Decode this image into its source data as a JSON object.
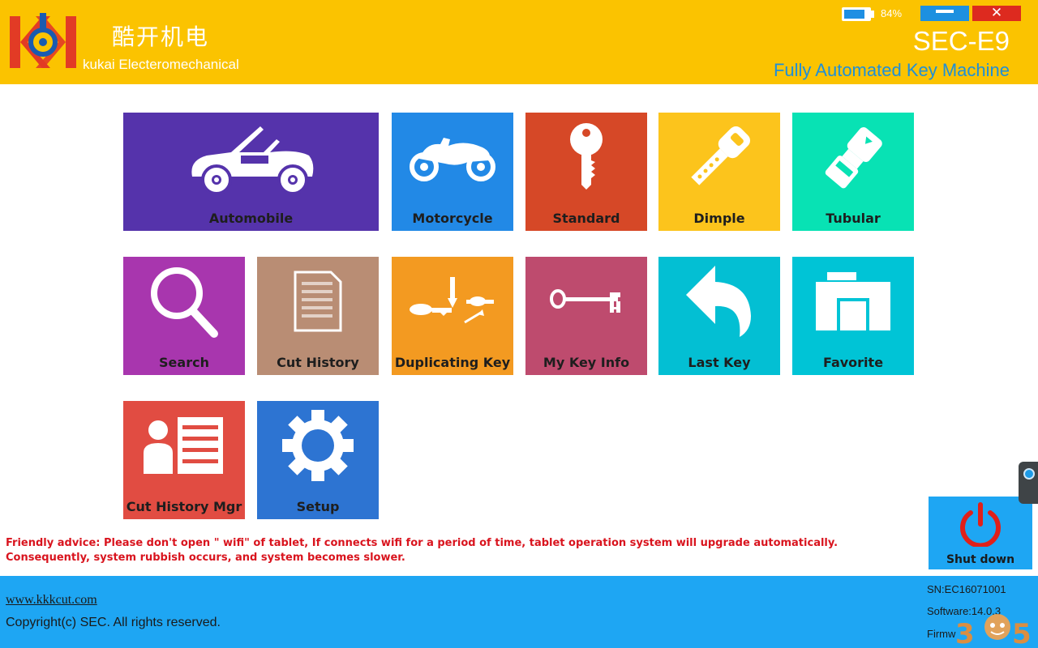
{
  "header": {
    "brand_cn": "酷开机电",
    "brand_en": "kukai Electeromechanical",
    "battery_percent": "84%",
    "battery_level": 0.84,
    "minimize_icon": "minimize-icon",
    "close_symbol": "✕",
    "model": "SEC-E9",
    "subtitle": "Fully Automated Key Machine"
  },
  "tiles": [
    {
      "label": "Automobile",
      "icon": "car-icon",
      "color": "#5533ab"
    },
    {
      "label": "Motorcycle",
      "icon": "motorcycle-icon",
      "color": "#2289e6"
    },
    {
      "label": "Standard",
      "icon": "key-icon",
      "color": "#d64827"
    },
    {
      "label": "Dimple",
      "icon": "dimple-key-icon",
      "color": "#fcc41c"
    },
    {
      "label": "Tubular",
      "icon": "tubular-key-icon",
      "color": "#08e2b4"
    },
    {
      "label": "Search",
      "icon": "magnifier-icon",
      "color": "#a836ae"
    },
    {
      "label": "Cut History",
      "icon": "document-icon",
      "color": "#b98d74"
    },
    {
      "label": "Duplicating Key",
      "icon": "duplicate-key-icon",
      "color": "#f39a21"
    },
    {
      "label": "My Key Info",
      "icon": "skeleton-key-icon",
      "color": "#be4b6e"
    },
    {
      "label": "Last Key",
      "icon": "back-arrow-icon",
      "color": "#03bfd3"
    },
    {
      "label": "Favorite",
      "icon": "folder-icon",
      "color": "#00c4d6"
    },
    {
      "label": "Cut History Mgr",
      "icon": "contact-card-icon",
      "color": "#e14c42"
    },
    {
      "label": "Setup",
      "icon": "gear-icon",
      "color": "#2d74d2"
    }
  ],
  "advice": "Friendly advice: Please don't open \" wifi\" of tablet, If connects wifi for a period of time, tablet operation system will upgrade automatically. Consequently, system rubbish occurs, and system becomes slower.",
  "shutdown": {
    "label": "Shut down",
    "icon": "power-icon"
  },
  "footer": {
    "website": "www.kkkcut.com",
    "copyright": "Copyright(c) SEC.  All rights reserved.",
    "sn": "SN:EC16071001",
    "software": "Software:14.0.3",
    "firmware": "Firmw"
  },
  "colors": {
    "header_bg": "#fbc300",
    "footer_bg": "#1ea6f3",
    "subtitle": "#1e8fd8",
    "advice": "#d9141e",
    "power": "#e0201a"
  }
}
